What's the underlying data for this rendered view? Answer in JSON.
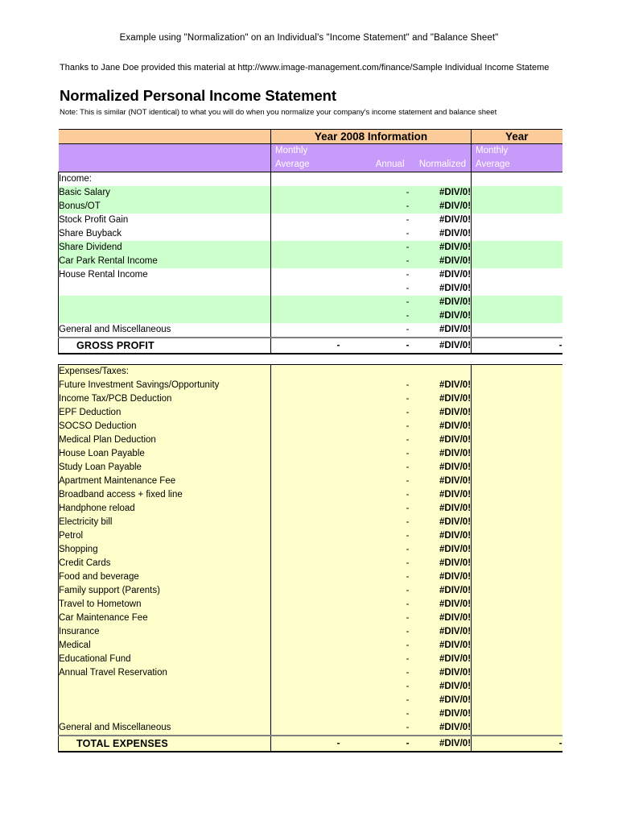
{
  "document": {
    "title": "Example using \"Normalization\" on an Individual's \"Income Statement\" and \"Balance Sheet\"",
    "credit": "Thanks to Jane Doe provided this material at http://www.image-management.com/finance/Sample Individual Income Stateme",
    "sheet_title": "Normalized Personal Income Statement",
    "note": "Note:  This is similar (NOT identical) to what you will do when you normalize your company's income statement and balance sheet"
  },
  "colors": {
    "header_band": "#FBCB99",
    "subheader_band": "#C89AFA",
    "income_highlight": "#CCFFCC",
    "expense_background": "#FFFFCC"
  },
  "table": {
    "group_headers": [
      {
        "label": "",
        "span": "label"
      },
      {
        "label": "Year 2008 Information",
        "span": "year1"
      },
      {
        "label": "Year",
        "span": "year2"
      }
    ],
    "sub_headers": {
      "label": "",
      "year1": {
        "monthly_average": "Monthly\nAverage",
        "annual": "Annual",
        "normalized": "Normalized"
      },
      "year2": {
        "monthly_average": "Monthly\nAverage"
      }
    },
    "income": {
      "section_label": "Income:",
      "rows": [
        {
          "label": "Basic Salary",
          "monthly_average": "",
          "annual": "-",
          "normalized": "#DIV/0!",
          "monthly_average_2": "",
          "shade": "green"
        },
        {
          "label": "Bonus/OT",
          "monthly_average": "",
          "annual": "-",
          "normalized": "#DIV/0!",
          "monthly_average_2": "",
          "shade": "green"
        },
        {
          "label": "Stock Profit Gain",
          "monthly_average": "",
          "annual": "-",
          "normalized": "#DIV/0!",
          "monthly_average_2": "",
          "shade": "white"
        },
        {
          "label": "Share Buyback",
          "monthly_average": "",
          "annual": "-",
          "normalized": "#DIV/0!",
          "monthly_average_2": "",
          "shade": "white"
        },
        {
          "label": "Share Dividend",
          "monthly_average": "",
          "annual": "-",
          "normalized": "#DIV/0!",
          "monthly_average_2": "",
          "shade": "green"
        },
        {
          "label": "Car Park Rental Income",
          "monthly_average": "",
          "annual": "-",
          "normalized": "#DIV/0!",
          "monthly_average_2": "",
          "shade": "green"
        },
        {
          "label": "House Rental Income",
          "monthly_average": "",
          "annual": "-",
          "normalized": "#DIV/0!",
          "monthly_average_2": "",
          "shade": "white"
        },
        {
          "label": "",
          "monthly_average": "",
          "annual": "-",
          "normalized": "#DIV/0!",
          "monthly_average_2": "",
          "shade": "white"
        },
        {
          "label": "",
          "monthly_average": "",
          "annual": "-",
          "normalized": "#DIV/0!",
          "monthly_average_2": "",
          "shade": "green"
        },
        {
          "label": "",
          "monthly_average": "",
          "annual": "-",
          "normalized": "#DIV/0!",
          "monthly_average_2": "",
          "shade": "green"
        },
        {
          "label": "General and Miscellaneous",
          "monthly_average": "",
          "annual": "-",
          "normalized": "#DIV/0!",
          "monthly_average_2": "",
          "shade": "white"
        }
      ],
      "total": {
        "label": "GROSS PROFIT",
        "monthly_average": "-",
        "annual": "-",
        "normalized": "#DIV/0!",
        "monthly_average_2": "-"
      }
    },
    "expenses": {
      "section_label": "Expenses/Taxes:",
      "rows": [
        {
          "label": "Future Investment Savings/Opportunity",
          "monthly_average": "",
          "annual": "-",
          "normalized": "#DIV/0!",
          "monthly_average_2": ""
        },
        {
          "label": "Income Tax/PCB Deduction",
          "monthly_average": "",
          "annual": "-",
          "normalized": "#DIV/0!",
          "monthly_average_2": ""
        },
        {
          "label": "EPF Deduction",
          "monthly_average": "",
          "annual": "-",
          "normalized": "#DIV/0!",
          "monthly_average_2": ""
        },
        {
          "label": "SOCSO Deduction",
          "monthly_average": "",
          "annual": "-",
          "normalized": "#DIV/0!",
          "monthly_average_2": ""
        },
        {
          "label": "Medical Plan Deduction",
          "monthly_average": "",
          "annual": "-",
          "normalized": "#DIV/0!",
          "monthly_average_2": ""
        },
        {
          "label": "House Loan Payable",
          "monthly_average": "",
          "annual": "-",
          "normalized": "#DIV/0!",
          "monthly_average_2": ""
        },
        {
          "label": "Study Loan Payable",
          "monthly_average": "",
          "annual": "-",
          "normalized": "#DIV/0!",
          "monthly_average_2": ""
        },
        {
          "label": "Apartment Maintenance Fee",
          "monthly_average": "",
          "annual": "-",
          "normalized": "#DIV/0!",
          "monthly_average_2": ""
        },
        {
          "label": "Broadband access + fixed line",
          "monthly_average": "",
          "annual": "-",
          "normalized": "#DIV/0!",
          "monthly_average_2": ""
        },
        {
          "label": "Handphone reload",
          "monthly_average": "",
          "annual": "-",
          "normalized": "#DIV/0!",
          "monthly_average_2": ""
        },
        {
          "label": "Electricity bill",
          "monthly_average": "",
          "annual": "-",
          "normalized": "#DIV/0!",
          "monthly_average_2": ""
        },
        {
          "label": "Petrol",
          "monthly_average": "",
          "annual": "-",
          "normalized": "#DIV/0!",
          "monthly_average_2": ""
        },
        {
          "label": "Shopping",
          "monthly_average": "",
          "annual": "-",
          "normalized": "#DIV/0!",
          "monthly_average_2": ""
        },
        {
          "label": "Credit Cards",
          "monthly_average": "",
          "annual": "-",
          "normalized": "#DIV/0!",
          "monthly_average_2": ""
        },
        {
          "label": "Food and beverage",
          "monthly_average": "",
          "annual": "-",
          "normalized": "#DIV/0!",
          "monthly_average_2": ""
        },
        {
          "label": "Family support (Parents)",
          "monthly_average": "",
          "annual": "-",
          "normalized": "#DIV/0!",
          "monthly_average_2": ""
        },
        {
          "label": "Travel to Hometown",
          "monthly_average": "",
          "annual": "-",
          "normalized": "#DIV/0!",
          "monthly_average_2": ""
        },
        {
          "label": "Car Maintenance Fee",
          "monthly_average": "",
          "annual": "-",
          "normalized": "#DIV/0!",
          "monthly_average_2": ""
        },
        {
          "label": "Insurance",
          "monthly_average": "",
          "annual": "-",
          "normalized": "#DIV/0!",
          "monthly_average_2": ""
        },
        {
          "label": "Medical",
          "monthly_average": "",
          "annual": "-",
          "normalized": "#DIV/0!",
          "monthly_average_2": ""
        },
        {
          "label": "Educational Fund",
          "monthly_average": "",
          "annual": "-",
          "normalized": "#DIV/0!",
          "monthly_average_2": ""
        },
        {
          "label": "Annual Travel Reservation",
          "monthly_average": "",
          "annual": "-",
          "normalized": "#DIV/0!",
          "monthly_average_2": ""
        },
        {
          "label": "",
          "monthly_average": "",
          "annual": "-",
          "normalized": "#DIV/0!",
          "monthly_average_2": ""
        },
        {
          "label": "",
          "monthly_average": "",
          "annual": "-",
          "normalized": "#DIV/0!",
          "monthly_average_2": ""
        },
        {
          "label": "",
          "monthly_average": "",
          "annual": "-",
          "normalized": "#DIV/0!",
          "monthly_average_2": ""
        },
        {
          "label": "General and Miscellaneous",
          "monthly_average": "",
          "annual": "-",
          "normalized": "#DIV/0!",
          "monthly_average_2": ""
        }
      ],
      "total": {
        "label": "TOTAL EXPENSES",
        "monthly_average": "-",
        "annual": "-",
        "normalized": "#DIV/0!",
        "monthly_average_2": "-"
      }
    }
  }
}
